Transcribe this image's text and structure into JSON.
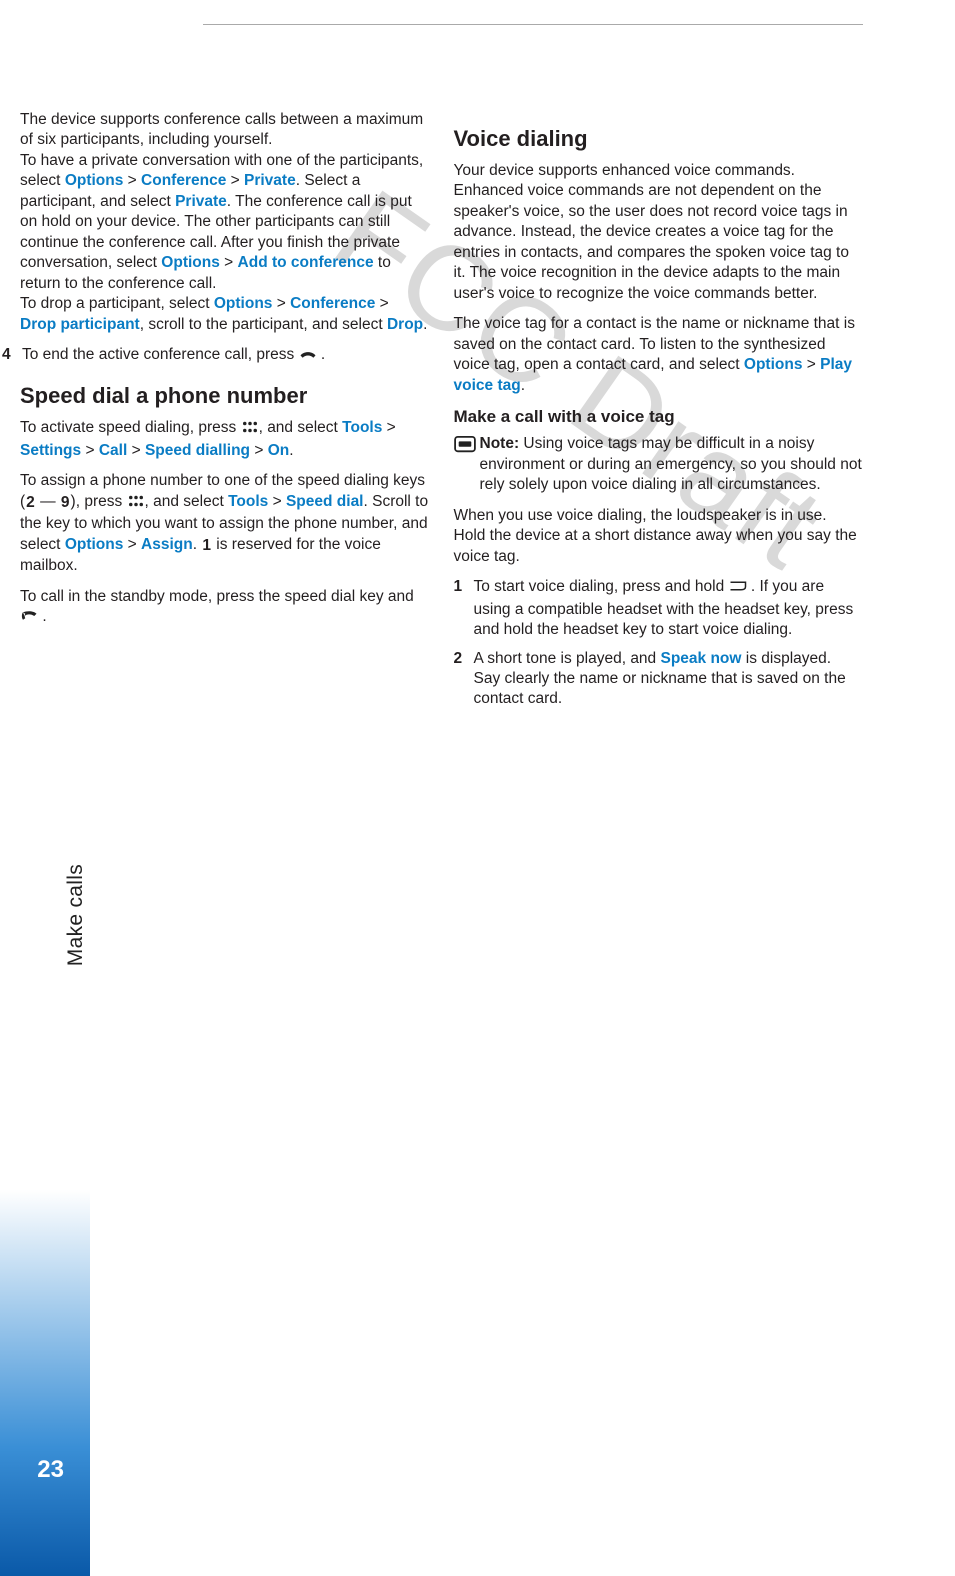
{
  "watermark": "FCC Draft",
  "side": {
    "label": "Make calls",
    "page_number": "23"
  },
  "left": {
    "p1_a": "The device supports conference calls between a maximum of six participants, including yourself.",
    "p1_b": "To have a private conversation with one of the participants, select ",
    "opt": "Options",
    "gt": " > ",
    "conf": "Conference",
    "priv": "Private",
    "p1_c": ". Select a participant, and select ",
    "p1_d": ". The conference call is put on hold on your device. The other participants can still continue the conference call. After you finish the private conversation, select ",
    "addconf": "Add to conference",
    "p1_e": " to return to the conference call.",
    "p1_f": "To drop a participant, select ",
    "droppart": "Drop participant",
    "p1_g": ", scroll to the participant, and select ",
    "drop": "Drop",
    "p1_h": ".",
    "step4": "4",
    "step4_txt": "To end the active conference call, press ",
    "period": ".",
    "h2": "Speed dial a phone number",
    "p2_a": "To activate speed dialing, press ",
    "p2_b": ", and select ",
    "tools": "Tools",
    "settings": "Settings",
    "call": "Call",
    "speeddialling": "Speed dialling",
    "on": "On",
    "p3_a": "To assign a phone number to one of the speed dialing keys (",
    "dash": " — ",
    "p3_b": "), press ",
    "speeddial": "Speed dial",
    "p3_c": ". Scroll to the key to which you want to assign the phone number, and select ",
    "assign": "Assign",
    "p3_d": ". ",
    "p3_e": " is reserved for the voice mailbox.",
    "p4_a": "To call in the standby mode, press the speed dial key and ",
    "key2": "2",
    "key9": "9",
    "key1": "1"
  },
  "right": {
    "h2": "Voice dialing",
    "p1": "Your device supports enhanced voice commands. Enhanced voice commands are not dependent on the speaker's voice, so the user does not record voice tags in advance. Instead, the device creates a voice tag for the entries in contacts, and compares the spoken voice tag to it. The voice recognition in the device adapts to the main user's voice to recognize the voice commands better.",
    "p2_a": "The voice tag for a contact is the name or nickname that is saved on the contact card. To listen to the synthesized voice tag, open a contact card, and select ",
    "opt": "Options",
    "gt": " > ",
    "playvt": "Play voice tag",
    "p2_b": ".",
    "h3": "Make a call with a voice tag",
    "note_bold": "Note:",
    "note": " Using voice tags may be difficult in a noisy environment or during an emergency, so you should not rely solely upon voice dialing in all circumstances.",
    "p3": "When you use voice dialing, the loudspeaker is in use. Hold the device at a short distance away when you say the voice tag.",
    "s1": "1",
    "s1_a": "To start voice dialing, press and hold ",
    "s1_b": ". If you are using a compatible headset with the headset key, press and hold the headset key to start voice dialing.",
    "s2": "2",
    "s2_a": "A short tone is played, and ",
    "speaknow": "Speak now",
    "s2_b": " is displayed. Say clearly the name or nickname that is saved on the contact card."
  }
}
